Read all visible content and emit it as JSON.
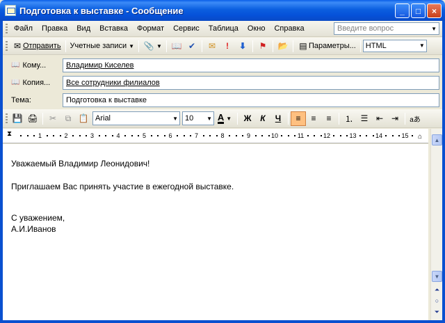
{
  "window": {
    "title": "Подготовка к выставке - Сообщение"
  },
  "menu": {
    "items": [
      "Файл",
      "Правка",
      "Вид",
      "Вставка",
      "Формат",
      "Сервис",
      "Таблица",
      "Окно",
      "Справка"
    ],
    "ask_placeholder": "Введите вопрос"
  },
  "toolbar": {
    "send_label": "Отправить",
    "accounts_label": "Учетные записи",
    "options_label": "Параметры...",
    "format_value": "HTML"
  },
  "header": {
    "to_label": "Кому...",
    "to_value": "Владимир Киселев",
    "cc_label": "Копия...",
    "cc_value": "Все сотрудники филиалов",
    "subject_label": "Тема:",
    "subject_value": "Подготовка к выставке"
  },
  "format": {
    "font": "Arial",
    "size": "10",
    "bold": "Ж",
    "italic": "К",
    "underline": "Ч",
    "font_color_label": "A"
  },
  "ruler": {
    "numbers": [
      "1",
      "2",
      "3",
      "4",
      "5",
      "6",
      "7",
      "8",
      "9",
      "10",
      "11",
      "12",
      "13",
      "14",
      "15"
    ]
  },
  "message": {
    "line1": "Уважаемый Владимир Леонидович!",
    "line2": "Приглашаем Вас принять участие в ежегодной выставке.",
    "line3": "С уважением,",
    "line4": "А.И.Иванов"
  }
}
